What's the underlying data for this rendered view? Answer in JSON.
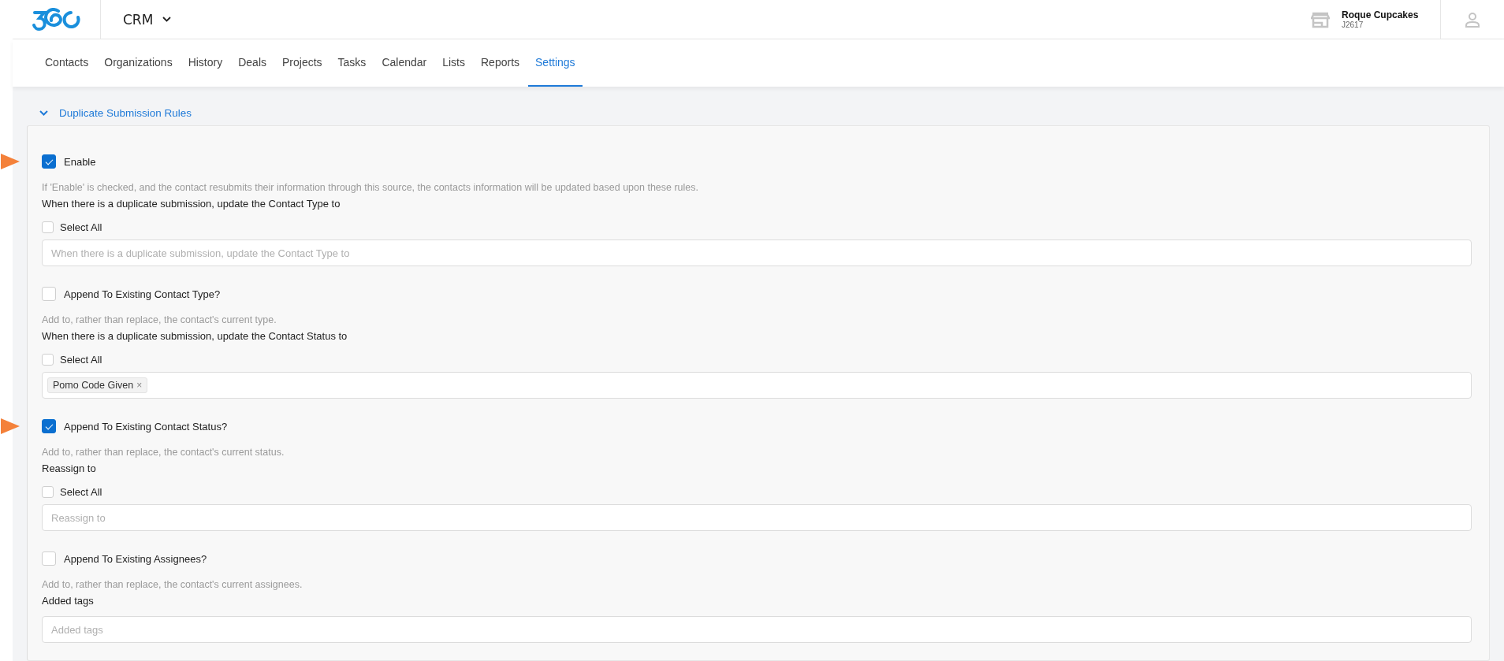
{
  "header": {
    "app_menu": "CRM",
    "account": {
      "name": "Roque Cupcakes",
      "id": "J2617"
    }
  },
  "nav": [
    {
      "label": "Contacts",
      "selected": false
    },
    {
      "label": "Organizations",
      "selected": false
    },
    {
      "label": "History",
      "selected": false
    },
    {
      "label": "Deals",
      "selected": false
    },
    {
      "label": "Projects",
      "selected": false
    },
    {
      "label": "Tasks",
      "selected": false
    },
    {
      "label": "Calendar",
      "selected": false
    },
    {
      "label": "Lists",
      "selected": false
    },
    {
      "label": "Reports",
      "selected": false
    },
    {
      "label": "Settings",
      "selected": true
    }
  ],
  "section": {
    "title": "Duplicate Submission Rules",
    "expanded": true,
    "items": [
      {
        "kind": "checkbox",
        "label": "Enable",
        "checked": true,
        "pointer": true
      },
      {
        "kind": "help",
        "text": "If 'Enable' is checked, and the contact resubmits their information through this source, the contacts information will be updated based upon these rules."
      },
      {
        "kind": "label",
        "text": "When there is a duplicate submission, update the Contact Type to"
      },
      {
        "kind": "select_all",
        "label": "Select All",
        "checked": false
      },
      {
        "kind": "input",
        "placeholder": "When there is a duplicate submission, update the Contact Type to"
      },
      {
        "kind": "checkbox",
        "label": "Append To Existing Contact Type?",
        "checked": false,
        "pointer": false
      },
      {
        "kind": "help",
        "text": "Add to, rather than replace, the contact's current type."
      },
      {
        "kind": "label",
        "text": "When there is a duplicate submission, update the Contact Status to"
      },
      {
        "kind": "select_all",
        "label": "Select All",
        "checked": false
      },
      {
        "kind": "tags",
        "tags": [
          {
            "label": "Pomo Code Given",
            "remove": "×"
          }
        ]
      },
      {
        "kind": "checkbox",
        "label": "Append To Existing Contact Status?",
        "checked": true,
        "pointer": true
      },
      {
        "kind": "help",
        "text": "Add to, rather than replace, the contact's current status."
      },
      {
        "kind": "label",
        "text": "Reassign to"
      },
      {
        "kind": "select_all",
        "label": "Select All",
        "checked": false
      },
      {
        "kind": "input",
        "placeholder": "Reassign to"
      },
      {
        "kind": "checkbox",
        "label": "Append To Existing Assignees?",
        "checked": false,
        "pointer": false
      },
      {
        "kind": "help",
        "text": "Add to, rather than replace, the contact's current assignees."
      },
      {
        "kind": "label",
        "text": "Added tags"
      },
      {
        "kind": "input",
        "placeholder": "Added tags"
      }
    ]
  }
}
